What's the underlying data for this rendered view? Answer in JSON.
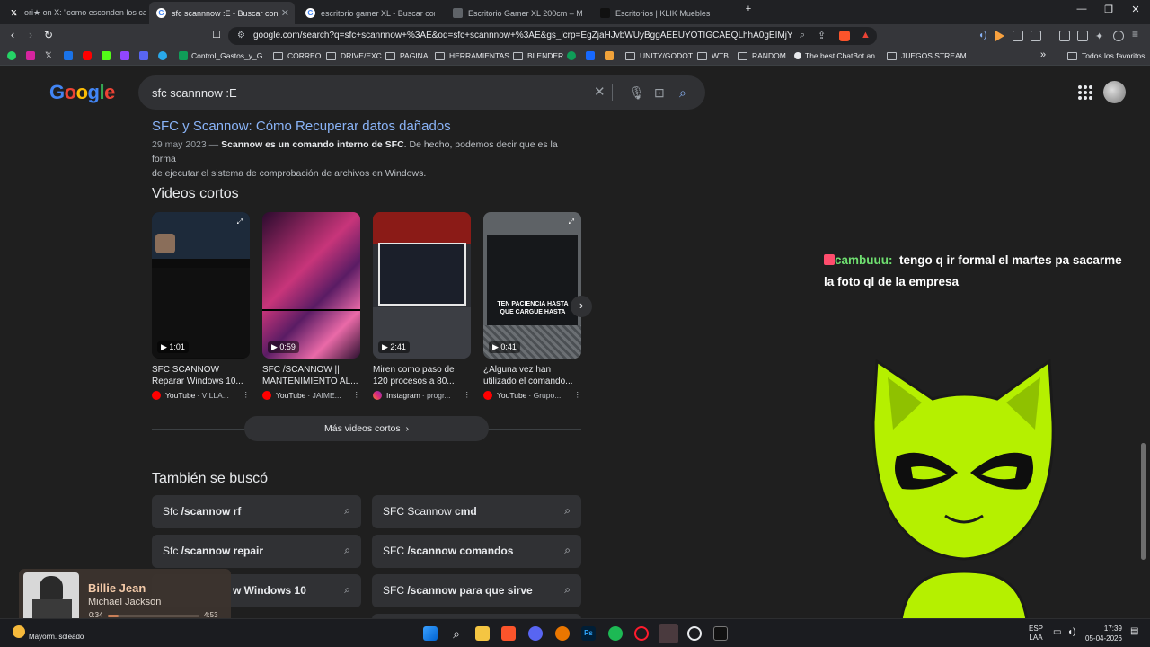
{
  "tabs": [
    {
      "label": "ori★ on X: \"como esconden los cable",
      "icon": "x-logo-icon"
    },
    {
      "label": "sfc scannnow :E - Buscar con Goo",
      "icon": "google-icon",
      "active": true
    },
    {
      "label": "escritorio gamer XL - Buscar con Goo",
      "icon": "google-icon"
    },
    {
      "label": "Escritorio Gamer XL 200cm – Moad C",
      "icon": "store-icon"
    },
    {
      "label": "Escritorios | KLIK Muebles",
      "icon": "klik-icon"
    }
  ],
  "address_bar": {
    "url": "google.com/search?q=sfc+scannnow+%3AE&oq=sfc+scannnow+%3AE&gs_lcrp=EgZjaHJvbWUyBggAEEUYOTIGCAEQLhhA0gEIMjY4MGowajS..."
  },
  "bookmarks": {
    "items": [
      "Control_Gastos_y_G...",
      "CORREO",
      "DRIVE/EXC",
      "PAGINA",
      "HERRAMIENTAS",
      "BLENDER",
      "UNITY/GODOT",
      "WTB",
      "RANDOM",
      "The best ChatBot an...",
      "JUEGOS STREAM"
    ],
    "all_label": "Todos los favoritos"
  },
  "google": {
    "logo": "Google",
    "query": "sfc scannnow :E"
  },
  "result": {
    "title": "SFC y Scannow: Cómo Recuperar datos dañados",
    "date": "29 may 2023 —",
    "bold": "Scannow es un comando interno de SFC",
    "rest_line1": ". De hecho, podemos decir que es la forma",
    "line2": "de ejecutar el sistema de comprobación de archivos en Windows."
  },
  "videos": {
    "heading": "Videos cortos",
    "items": [
      {
        "duration": "1:01",
        "title": "SFC SCANNOW Reparar Windows 10...",
        "platform": "YouTube",
        "channel": "VILLA..."
      },
      {
        "duration": "0:59",
        "title": "SFC /SCANNOW || MANTENIMIENTO AL...",
        "platform": "YouTube",
        "channel": "JAIME..."
      },
      {
        "duration": "2:41",
        "title": "Miren como paso de 120 procesos a 80...",
        "platform": "Instagram",
        "channel": "progr..."
      },
      {
        "duration": "0:41",
        "title": "¿Alguna vez han utilizado el comando...",
        "platform": "YouTube",
        "channel": "Grupo..."
      }
    ],
    "more": "Más videos cortos",
    "thumb4_caption": "TEN PACIENCIA HASTA QUE CARGUE HASTA"
  },
  "related": {
    "heading": "También se buscó",
    "items": [
      {
        "pre": "Sfc ",
        "bold": "/scannow rf"
      },
      {
        "pre": "SFC Scannow ",
        "bold": "cmd"
      },
      {
        "pre": "Sfc ",
        "bold": "/scannow repair"
      },
      {
        "pre": "SFC ",
        "bold": "/scannow comandos"
      },
      {
        "pre": "",
        "bold": "w Windows 10"
      },
      {
        "pre": "SFC ",
        "bold": "/scannow para que sirve"
      }
    ]
  },
  "chat": {
    "user": "cambuuu:",
    "message": "tengo q ir formal el martes pa sacarme la foto ql de la empresa"
  },
  "player": {
    "song": "Billie Jean",
    "artist": "Michael Jackson",
    "elapsed": "0:34",
    "total": "4:53",
    "progress": 0.116
  },
  "taskbar": {
    "weather": "Mayorm. soleado",
    "lang1": "ESP",
    "lang2": "LAA",
    "time": "17:39",
    "date": "05-04-2026"
  },
  "colors": {
    "link": "#8ab4f8",
    "chat_user": "#6fe070",
    "avatar_green": "#b5f000"
  }
}
